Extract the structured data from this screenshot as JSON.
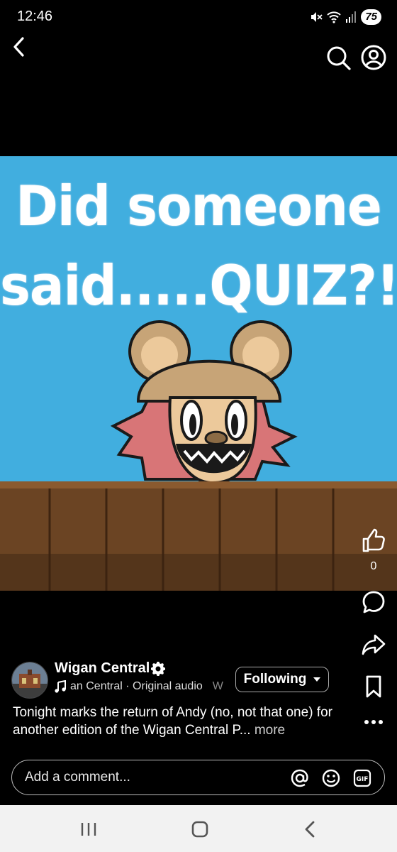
{
  "status": {
    "time": "12:46",
    "battery": "75",
    "icons": [
      "mute-icon",
      "wifi-icon",
      "signal-icon",
      "battery-icon"
    ]
  },
  "nav": {
    "back_icon": "back-arrow-icon",
    "search_icon": "search-icon",
    "profile_icon": "profile-icon"
  },
  "media": {
    "headline_line1": "Did someone",
    "headline_line2": "said.....QUIZ?!",
    "background_color": "#41aedf"
  },
  "actions": {
    "like_count": "0",
    "icons": [
      "like-icon",
      "comment-icon",
      "share-icon",
      "save-icon",
      "more-icon"
    ]
  },
  "post": {
    "author": "Wigan Central",
    "audio": "an Central · Original audio",
    "audio_overflow": "W",
    "follow_label": "Following",
    "caption": "Tonight marks the return of Andy (no, not that one) for another edition of the Wigan Central P...",
    "more_label": "more"
  },
  "comment": {
    "placeholder": "Add a comment..."
  }
}
